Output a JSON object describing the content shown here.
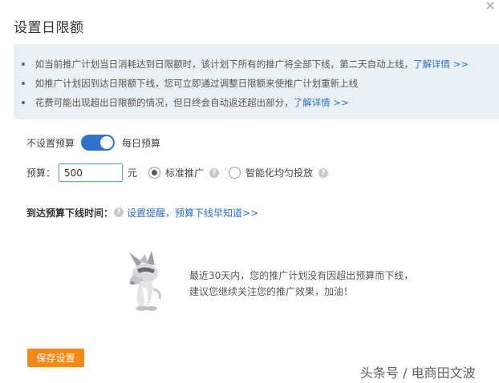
{
  "dialog": {
    "title": "设置日限额"
  },
  "notice": {
    "items": [
      {
        "text": "如当前推广计划当日消耗达到日限额时，该计划下所有的推广将全部下线，第二天自动上线，",
        "link": "了解详情 >>"
      },
      {
        "text": "如推广计划因到达日限额下线，您可立即通过调整日限额来使推广计划重新上线",
        "link": ""
      },
      {
        "text": "花费可能出现超出日限额的情况，但日终会自动返还超出部分，",
        "link": "了解详情 >>"
      }
    ]
  },
  "budget_toggle": {
    "off_label": "不设置预算",
    "on_label": "每日预算",
    "state": "on"
  },
  "budget": {
    "label": "预算：",
    "value": "500",
    "unit": "元",
    "options": [
      {
        "label": "标准推广",
        "selected": true
      },
      {
        "label": "智能化均匀投放",
        "selected": false
      }
    ]
  },
  "offline_time": {
    "label": "到达预算下线时间：",
    "link": "设置提醒，预算下线早知道>>"
  },
  "empty_state": {
    "line1": "最近30天内，您的推广计划没有因超出预算而下线，",
    "line2": "建议您继续关注您的推广效果，加油！"
  },
  "actions": {
    "save_label": "保存设置"
  },
  "watermark": "头条号 / 电商田文波",
  "colors": {
    "accent": "#2f74c8",
    "link": "#2a6fbd",
    "notice_bg": "#e9f1f6",
    "save_button": "#f08a1c"
  }
}
